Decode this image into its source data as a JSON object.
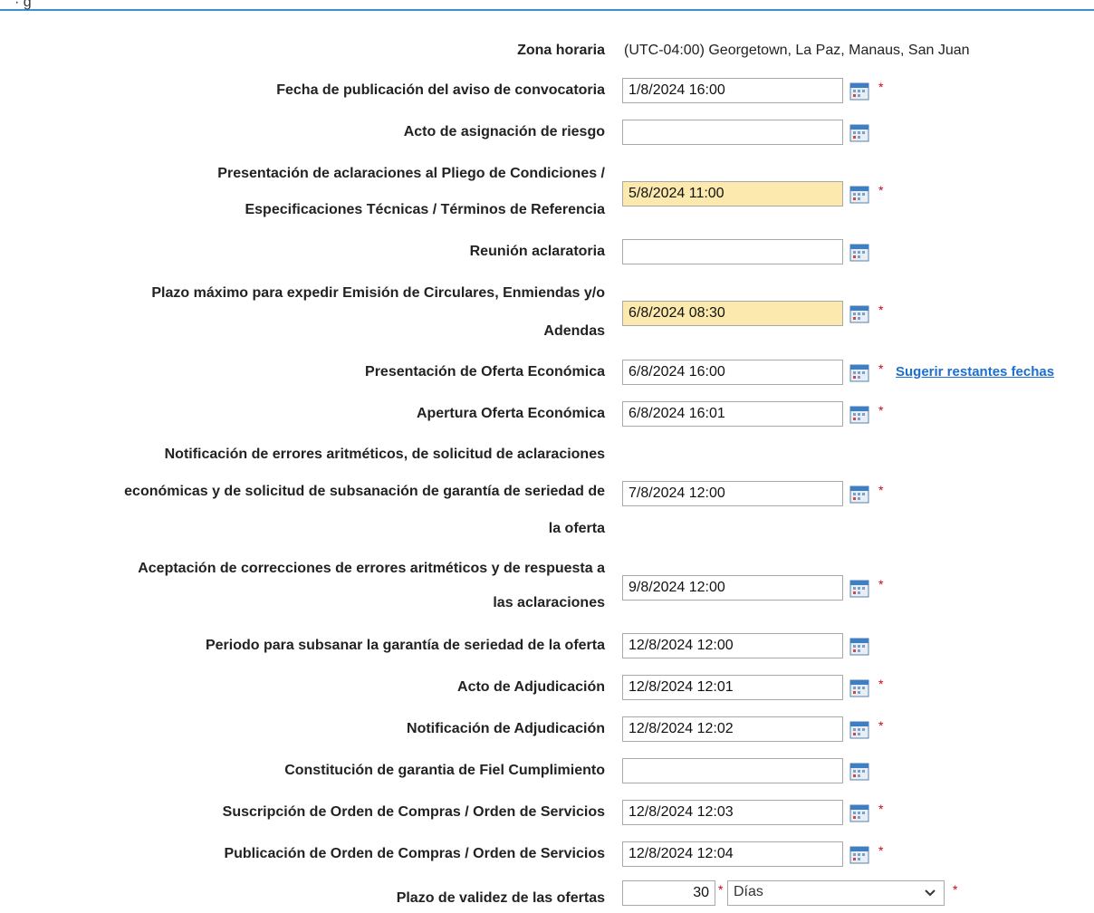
{
  "header": {
    "cut_text": "· g"
  },
  "fields": {
    "zona": {
      "label": "Zona horaria",
      "value": "(UTC-04:00) Georgetown, La Paz, Manaus, San Juan"
    },
    "r1": {
      "label": "Fecha de publicación del aviso de convocatoria",
      "value": "1/8/2024 16:00"
    },
    "r2": {
      "label": "Acto de asignación de riesgo",
      "value": ""
    },
    "r3": {
      "label_line1": "Presentación de aclaraciones al Pliego de Condiciones /",
      "label_line2": "Especificaciones Técnicas / Términos de Referencia",
      "value": "5/8/2024 11:00"
    },
    "r4": {
      "label": "Reunión aclaratoria",
      "value": ""
    },
    "r5": {
      "label_line1": "Plazo máximo para expedir Emisión de Circulares, Enmiendas y/o",
      "label_line2": "Adendas",
      "value": "6/8/2024 08:30"
    },
    "r6": {
      "label": "Presentación de Oferta Económica",
      "value": "6/8/2024 16:00",
      "link": "Sugerir restantes fechas"
    },
    "r7": {
      "label": "Apertura Oferta Económica",
      "value": "6/8/2024 16:01"
    },
    "r8": {
      "label_line1": "Notificación de errores aritméticos, de solicitud de aclaraciones",
      "label_line2": "económicas y de solicitud de subsanación de garantía de seriedad de",
      "label_line3": "la oferta",
      "value": "7/8/2024 12:00"
    },
    "r9": {
      "label_line1": "Aceptación de correcciones de errores aritméticos y de respuesta a",
      "label_line2": "las aclaraciones",
      "value": "9/8/2024 12:00"
    },
    "r10": {
      "label": "Periodo para subsanar la garantía de seriedad de la oferta",
      "value": "12/8/2024 12:00"
    },
    "r11": {
      "label": "Acto de Adjudicación",
      "value": "12/8/2024 12:01"
    },
    "r12": {
      "label": "Notificación de Adjudicación",
      "value": "12/8/2024 12:02"
    },
    "r13": {
      "label": "Constitución de garantia de Fiel Cumplimiento",
      "value": ""
    },
    "r14": {
      "label": "Suscripción de Orden de Compras / Orden de Servicios",
      "value": "12/8/2024 12:03"
    },
    "r15": {
      "label": "Publicación de Orden de Compras / Orden de Servicios",
      "value": "12/8/2024 12:04"
    },
    "r16": {
      "label": "Plazo de validez de las ofertas",
      "number": "30",
      "unit": "Días"
    }
  },
  "required_mark": "*",
  "colors": {
    "highlight": "#fbe9ad",
    "required": "#d0021b",
    "link": "#1a6fd1",
    "top_line": "#3b8fd6"
  }
}
